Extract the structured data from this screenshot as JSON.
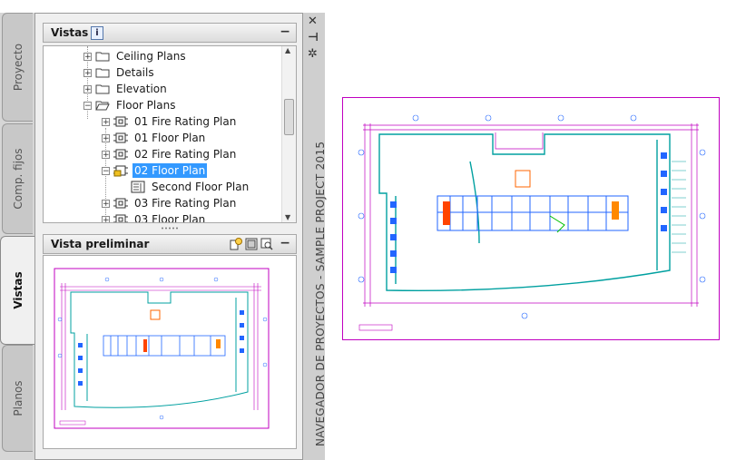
{
  "palette": {
    "title": "NAVEGADOR DE PROYECTOS - SAMPLE PROJECT 2015",
    "tabs": [
      {
        "label": "Proyecto",
        "active": false
      },
      {
        "label": "Comp. fijos",
        "active": false
      },
      {
        "label": "Vistas",
        "active": true
      },
      {
        "label": "Planos",
        "active": false
      }
    ],
    "controls": {
      "close": "✕",
      "pin": "⊣",
      "settings": "✲"
    }
  },
  "views_section": {
    "title": "Vistas",
    "info_icon": "i",
    "collapse": "−",
    "tree": [
      {
        "label": "Ceiling Plans",
        "type": "folder",
        "expanded": false
      },
      {
        "label": "Details",
        "type": "folder",
        "expanded": false
      },
      {
        "label": "Elevation",
        "type": "folder",
        "expanded": false
      },
      {
        "label": "Floor Plans",
        "type": "folder-open",
        "expanded": true
      },
      {
        "label": "01 Fire Rating Plan",
        "type": "view",
        "expanded": false
      },
      {
        "label": "01 Floor Plan",
        "type": "view",
        "expanded": false
      },
      {
        "label": "02 Fire Rating Plan",
        "type": "view",
        "expanded": false
      },
      {
        "label": "02 Floor Plan",
        "type": "view-locked",
        "expanded": true,
        "selected": true
      },
      {
        "label": "Second Floor Plan",
        "type": "sheet",
        "expanded": false
      },
      {
        "label": "03 Fire Rating Plan",
        "type": "view",
        "expanded": false
      },
      {
        "label": "03 Floor Plan",
        "type": "view",
        "expanded": false
      }
    ]
  },
  "preview_section": {
    "title": "Vista preliminar",
    "collapse": "−"
  },
  "colors": {
    "selection": "#3399ff",
    "sheet_border": "#c000c0",
    "walls": "#00a0a0",
    "dims": "#c000c0",
    "core": "#2266ff",
    "stairs": "#ff4400"
  }
}
